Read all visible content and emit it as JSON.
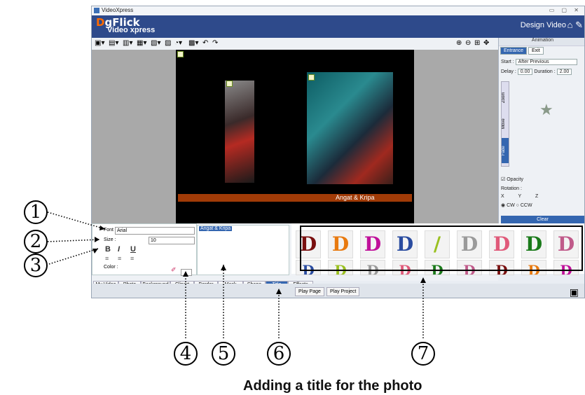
{
  "window": {
    "title": "VideoXpress",
    "controls": "▭ ▢ ✕"
  },
  "header": {
    "logo_d": "D",
    "logo_rest": "gFlick",
    "logo_sub": "Video xpress",
    "mode": "Design Video"
  },
  "stage": {
    "title_text": "Angat & Kripa"
  },
  "animation_panel": {
    "title": "Animation",
    "tabs": [
      "Entrance",
      "Exit"
    ],
    "start_label": "Start :",
    "start_value": "After Previous",
    "delay_label": "Delay :",
    "delay_value": "0.00",
    "duration_label": "Duration :",
    "duration_value": "2.00",
    "vertical_tabs": [
      "Zoom",
      "Move",
      "Fade"
    ],
    "opacity_label": "Opacity",
    "rotation_label": "Rotation :",
    "axes": [
      "X",
      "Y",
      "Z"
    ],
    "direction": [
      "CW",
      "CCW"
    ],
    "clear_label": "Clear"
  },
  "title_props": {
    "font_label": "Font :",
    "font_value": "Arial",
    "size_label": "Size :",
    "size_value": "10",
    "bold": "B",
    "italic": "I",
    "underline": "U",
    "color_label": "Color :"
  },
  "text_input": {
    "value": "Angat & Kripa"
  },
  "effects": {
    "row1": [
      "D",
      "D",
      "D",
      "D",
      "/",
      "D",
      "D",
      "D",
      "D"
    ],
    "colors": [
      "#7a1010",
      "#e87a10",
      "#c0109a",
      "#2a4ca0",
      "#9ac020",
      "#9a9a9a",
      "#e05a7a",
      "#1a7a1a",
      "#c05a8a"
    ]
  },
  "bottom_tabs": [
    "My Video",
    "Photo",
    "Background",
    "Clipart",
    "Border",
    "Mask",
    "Shape",
    "Title",
    "Effects"
  ],
  "play": {
    "page": "Play Page",
    "project": "Play Project"
  },
  "callouts": [
    "1",
    "2",
    "3",
    "4",
    "5",
    "6",
    "7"
  ],
  "caption": "Adding a title for the photo"
}
